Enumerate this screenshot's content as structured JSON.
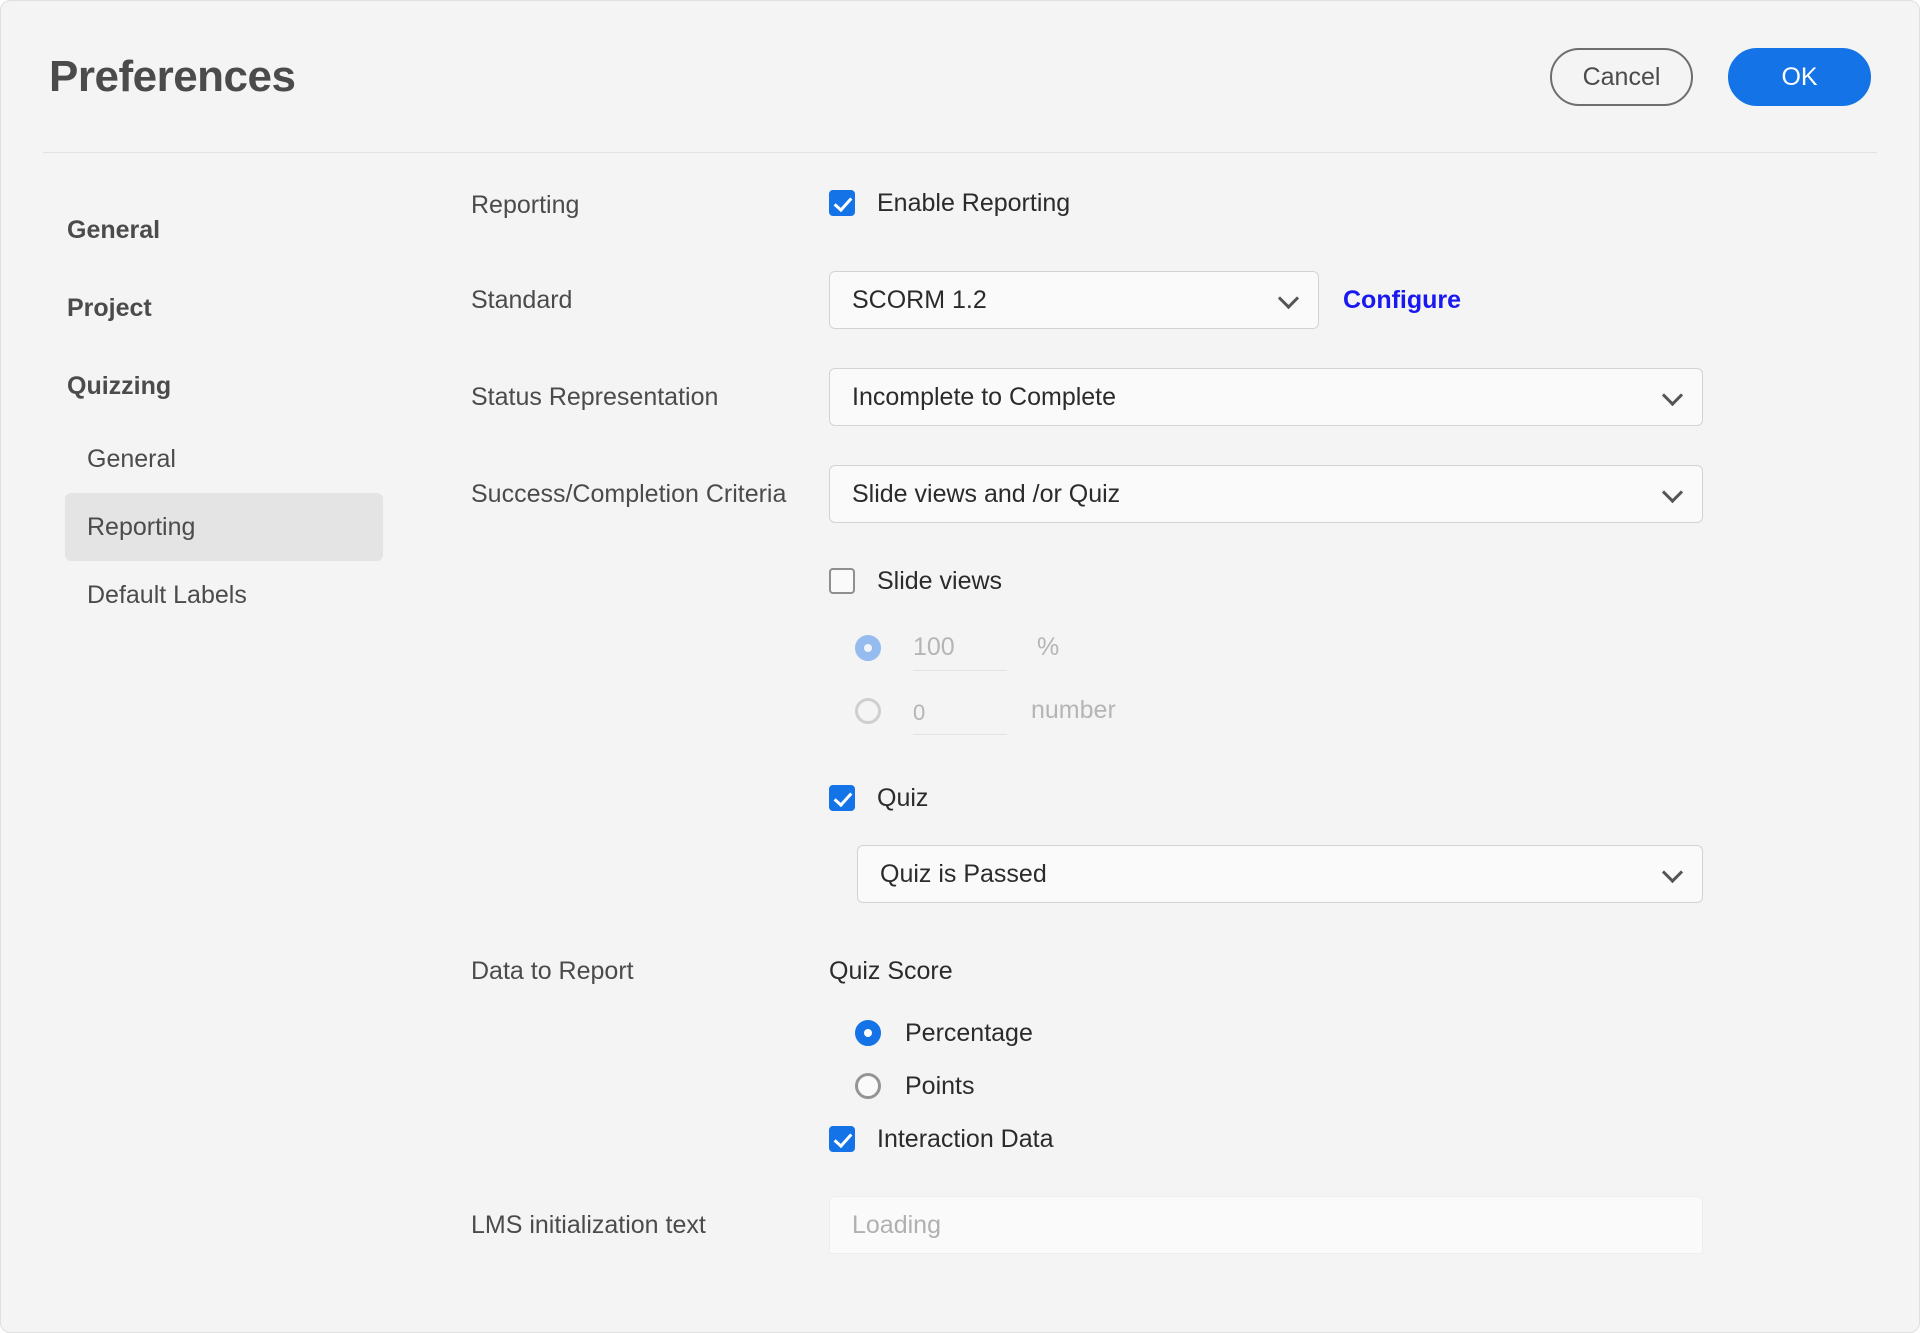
{
  "header": {
    "title": "Preferences",
    "cancel_label": "Cancel",
    "ok_label": "OK"
  },
  "sidebar": {
    "top_items": [
      {
        "label": "General"
      },
      {
        "label": "Project"
      },
      {
        "label": "Quizzing"
      }
    ],
    "sub_items": [
      {
        "label": "General",
        "active": false
      },
      {
        "label": "Reporting",
        "active": true
      },
      {
        "label": "Default Labels",
        "active": false
      }
    ]
  },
  "form": {
    "reporting": {
      "label": "Reporting",
      "enable_label": "Enable Reporting",
      "enabled": true
    },
    "standard": {
      "label": "Standard",
      "value": "SCORM 1.2",
      "configure_label": "Configure"
    },
    "status_representation": {
      "label": "Status Representation",
      "value": "Incomplete to Complete"
    },
    "success_criteria": {
      "label": "Success/Completion Criteria",
      "value": "Slide views and /or Quiz",
      "slide_views": {
        "label": "Slide views",
        "checked": false,
        "percent_value": "100",
        "percent_unit": "%",
        "number_value": "0",
        "number_unit": "number",
        "selected_mode": "percent"
      },
      "quiz": {
        "label": "Quiz",
        "checked": true,
        "value": "Quiz is Passed"
      }
    },
    "data_to_report": {
      "label": "Data to Report",
      "quiz_score_label": "Quiz Score",
      "options": [
        {
          "label": "Percentage",
          "selected": true
        },
        {
          "label": "Points",
          "selected": false
        }
      ],
      "interaction_data": {
        "label": "Interaction Data",
        "checked": true
      }
    },
    "lms_init": {
      "label": "LMS initialization text",
      "placeholder": "Loading"
    }
  },
  "colors": {
    "accent": "#1473e6",
    "link": "#1a18f0",
    "surface": "#f4f4f4"
  }
}
